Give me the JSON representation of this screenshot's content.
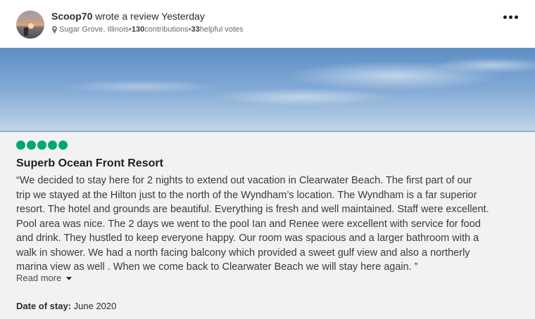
{
  "review": {
    "username": "Scoop70",
    "action": " wrote a review ",
    "when": "Yesterday",
    "location": "Sugar Grove, Illinois",
    "sep1": " • ",
    "contributions_count": "130",
    "contributions_label": " contributions",
    "sep2": " • ",
    "helpful_count": "33",
    "helpful_label": " helpful votes",
    "more_icon": "more-options-icon",
    "rating": 5,
    "rating_color": "#00aa6c",
    "title": "Superb Ocean Front Resort",
    "body_lines": [
      "“We decided to stay here for 2 nights to extend out vacation in Clearwater Beach. The first part of our",
      "trip we stayed at the Hilton just to the north of the Wyndham’s location. The Wyndham is a far superior",
      "resort. The hotel and grounds are beautiful. Everything is fresh and well maintained. Staff were excellent.",
      "Pool area was nice. The 2 days we went to the pool Ian and Renee were excellent with service for food",
      "and drink. They hustled to keep everyone happy. Our room was spacious and a larger bathroom with a",
      "walk in shower. We had a north facing balcony which provided a sweet gulf view and also a northerly",
      "marina view as well . When we come back to Clearwater Beach we will stay here again. ”"
    ],
    "read_more": "Read more",
    "stay_label": "Date of stay:",
    "stay_value": " June 2020"
  }
}
